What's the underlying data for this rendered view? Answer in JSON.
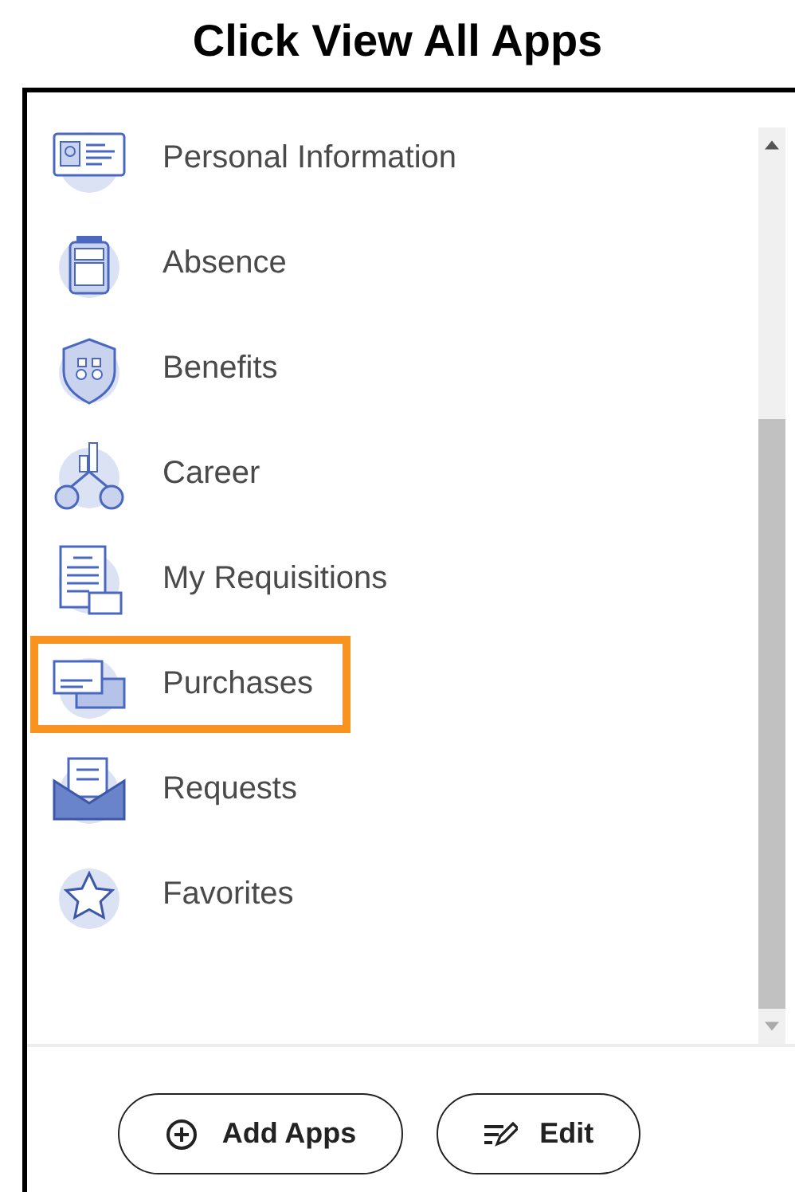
{
  "heading": "Click View All Apps",
  "apps": [
    {
      "label": "Personal Information",
      "highlighted": false
    },
    {
      "label": "Absence",
      "highlighted": false
    },
    {
      "label": "Benefits",
      "highlighted": false
    },
    {
      "label": "Career",
      "highlighted": false
    },
    {
      "label": "My Requisitions",
      "highlighted": false
    },
    {
      "label": "Purchases",
      "highlighted": true
    },
    {
      "label": "Requests",
      "highlighted": false
    },
    {
      "label": "Favorites",
      "highlighted": false
    }
  ],
  "buttons": [
    {
      "kind": "add",
      "label": "Add Apps"
    },
    {
      "kind": "edit",
      "label": "Edit"
    }
  ]
}
